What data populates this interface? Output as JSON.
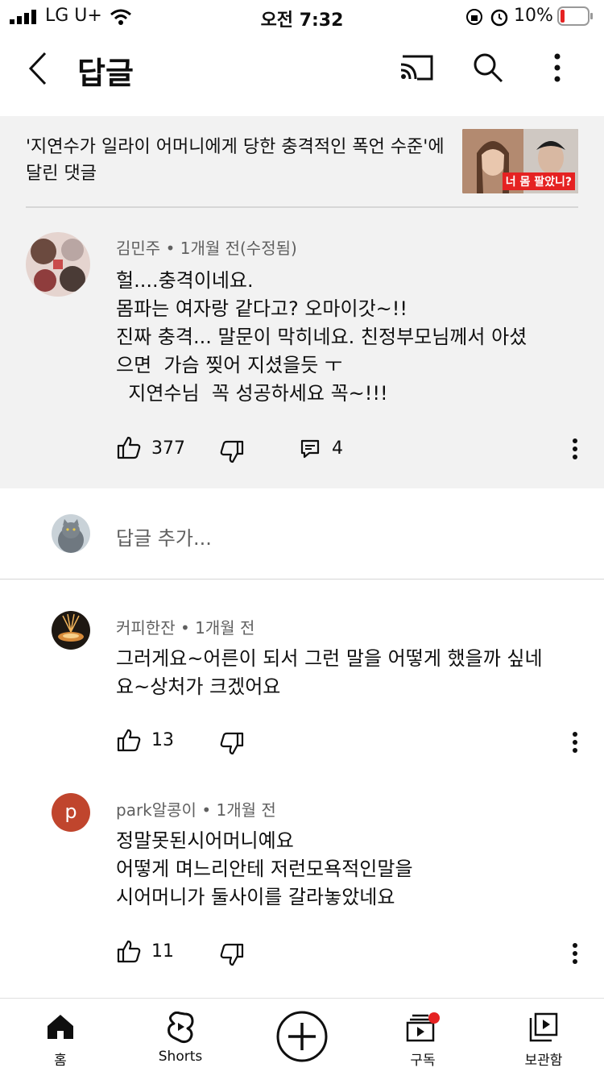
{
  "status_bar": {
    "carrier": "LG U+",
    "time": "오전 7:32",
    "battery_percent": "10%"
  },
  "header": {
    "title": "답글",
    "icons": [
      "back-arrow-icon",
      "cast-icon",
      "search-icon",
      "more-vert-icon"
    ]
  },
  "video": {
    "title": "'지연수가 일라이 어머니에게 당한 충격적인 폭언 수준'에 달린 댓글",
    "thumbnail_caption": "너 몸 팔았니?"
  },
  "original_comment": {
    "author": "김민주",
    "time": "1개월 전(수정됨)",
    "text": "헐....충격이네요.\n몸파는 여자랑 같다고? 오마이갓~!!\n진짜 충격... 말문이 막히네요. 친정부모님께서 아셨\n으면  가슴 찢어 지셨을듯 ㅜ\n  지연수님  꼭 성공하세요 꼭~!!!",
    "likes": "377",
    "replies": "4"
  },
  "reply_input": {
    "placeholder": "답글 추가..."
  },
  "replies": [
    {
      "author": "커피한잔",
      "time": "1개월 전",
      "text": "그러게요~어른이 되서 그런 말을 어떻게 했을까 싶네\n요~상처가 크겠어요",
      "likes": "13"
    },
    {
      "author": "park알콩이",
      "time": "1개월 전",
      "text": "정말못된시어머니예요\n어떻게 며느리안테 저런모욕적인말을\n시어머니가 둘사이를 갈라놓았네요",
      "likes": "11",
      "avatar_letter": "p"
    }
  ],
  "bottom_nav": {
    "home": "홈",
    "shorts": "Shorts",
    "subscriptions": "구독",
    "library": "보관함"
  },
  "colors": {
    "accent_red": "#e52222",
    "context_bg": "#f2f2f2",
    "avatar_p": "#c0452d"
  }
}
